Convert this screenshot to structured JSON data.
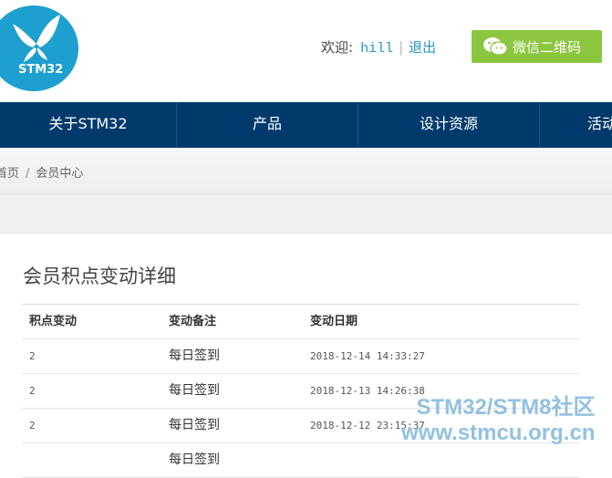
{
  "header": {
    "logo_text": "STM32",
    "welcome_label": "欢迎:",
    "username": "hill",
    "logout_label": "退出",
    "wechat_button_label": "微信二维码"
  },
  "nav": {
    "items": [
      "关于STM32",
      "产品",
      "设计资源",
      "活动"
    ]
  },
  "breadcrumb": {
    "home": "首页",
    "separator": "/",
    "current": "会员中心"
  },
  "main": {
    "title": "会员积点变动详细",
    "table": {
      "headers": [
        "积点变动",
        "变动备注",
        "变动日期"
      ],
      "rows": [
        {
          "points": "2",
          "note": "每日签到",
          "date": "2018-12-14 14:33:27"
        },
        {
          "points": "2",
          "note": "每日签到",
          "date": "2018-12-13 14:26:38"
        },
        {
          "points": "2",
          "note": "每日签到",
          "date": "2018-12-12 23:15:37"
        },
        {
          "points": "",
          "note": "每日签到",
          "date": ""
        }
      ]
    }
  },
  "watermark": {
    "line1": "STM32/STM8社区",
    "line2": "www.stmcu.org.cn"
  },
  "colors": {
    "nav_bg": "#003a6c",
    "logo_bg": "#1da0cf",
    "wechat_green": "#8cc63f",
    "link_blue": "#2a93c3"
  }
}
